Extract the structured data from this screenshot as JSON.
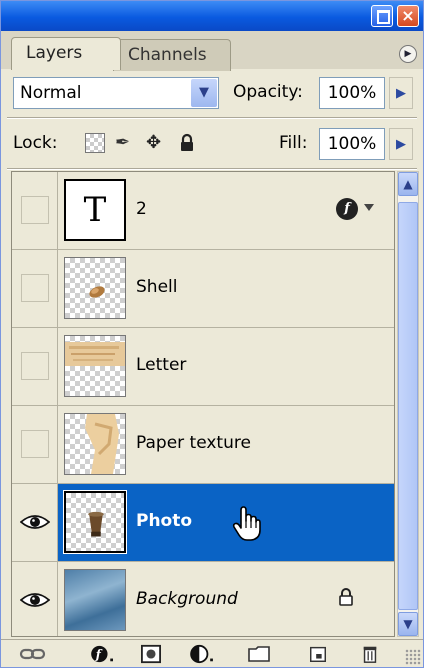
{
  "window": {
    "close_glyph": "×"
  },
  "tabs": [
    {
      "label": "Layers",
      "active": true
    },
    {
      "label": "Channels",
      "active": false
    }
  ],
  "blend": {
    "mode": "Normal",
    "opacity_label": "Opacity:",
    "opacity_value": "100%"
  },
  "lock": {
    "label": "Lock:",
    "fill_label": "Fill:",
    "fill_value": "100%"
  },
  "layers": [
    {
      "name": "2",
      "type": "text",
      "visible": false,
      "selected": false,
      "has_effects": true
    },
    {
      "name": "Shell",
      "type": "image",
      "visible": false,
      "selected": false
    },
    {
      "name": "Letter",
      "type": "image",
      "visible": false,
      "selected": false
    },
    {
      "name": "Paper texture",
      "type": "image",
      "visible": false,
      "selected": false
    },
    {
      "name": "Photo",
      "type": "image",
      "visible": true,
      "selected": true
    },
    {
      "name": "Background",
      "type": "background",
      "visible": true,
      "selected": false,
      "locked": true
    }
  ],
  "thumb_text_glyph": "T",
  "fx_glyph": "f",
  "icons": {
    "window": [
      "minimize-icon",
      "close-icon"
    ],
    "tab_menu": "palette-menu-icon",
    "lock": [
      "lock-transparent-pixels-icon",
      "lock-image-pixels-icon",
      "lock-position-icon",
      "lock-all-icon"
    ],
    "bottom": [
      "link-layers-icon",
      "layer-style-icon",
      "layer-mask-icon",
      "adjustment-layer-icon",
      "new-group-icon",
      "new-layer-icon",
      "delete-layer-icon"
    ]
  },
  "colors": {
    "selection": "#0a63c5",
    "panel": "#ece9d8",
    "titlebar": "#0a5ae0"
  }
}
